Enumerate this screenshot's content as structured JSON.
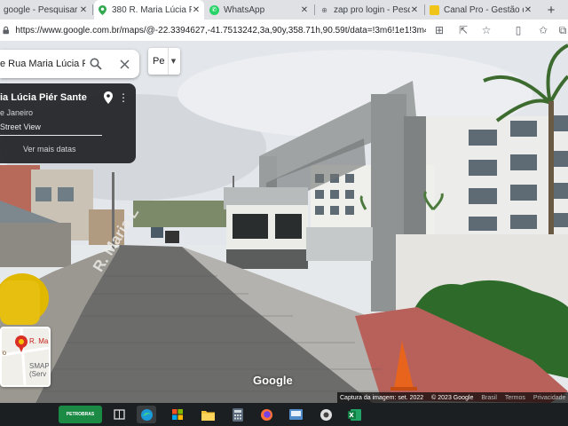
{
  "browser": {
    "tabs": [
      {
        "label": "google - Pesquisar",
        "icon": "google-favicon",
        "active": false
      },
      {
        "label": "380 R. Maria Lúcia Piér",
        "icon": "maps-pin-favicon",
        "active": true
      },
      {
        "label": "WhatsApp",
        "icon": "whatsapp-favicon",
        "active": false
      },
      {
        "label": "zap pro login - Pesquis",
        "icon": "search-favicon",
        "active": false
      },
      {
        "label": "Canal Pro - Gestão de",
        "icon": "canalpro-favicon",
        "active": false
      }
    ],
    "new_tab_symbol": "+",
    "close_symbol": "✕",
    "url": "https://www.google.com.br/maps/@-22.3394627,-41.7513242,3a,90y,358.71h,90.59t/data=!3m6!1e1!3m4!1sh..."
  },
  "maps": {
    "search_value": "e Rua Maria Lúcia P",
    "pegman_label": "Pe",
    "place": {
      "title": "ia Lúcia Piér Sante",
      "subtitle": "e Janeiro",
      "street_view_label": "Street View",
      "see_more": "Ver mais datas"
    },
    "minimap": {
      "label_left": "ro",
      "label_pin": "R. Ma",
      "label_smap": "SMAP",
      "label_serv": "(Serv"
    },
    "street_sign": "R. Maria L",
    "logo_text": "Google",
    "attribution": {
      "capture": "Captura da imagem: set. 2022",
      "copyright": "© 2023 Google",
      "brasil": "Brasil",
      "terms": "Termos",
      "privacy": "Privacidade"
    }
  },
  "taskbar": {
    "pinned_app_label": "PETROBRAS"
  },
  "colors": {
    "tab_bar": "#dfe1e5",
    "card_bg": "#202124",
    "taskbar": "#1c1f22",
    "accent_green": "#1a8a45"
  }
}
